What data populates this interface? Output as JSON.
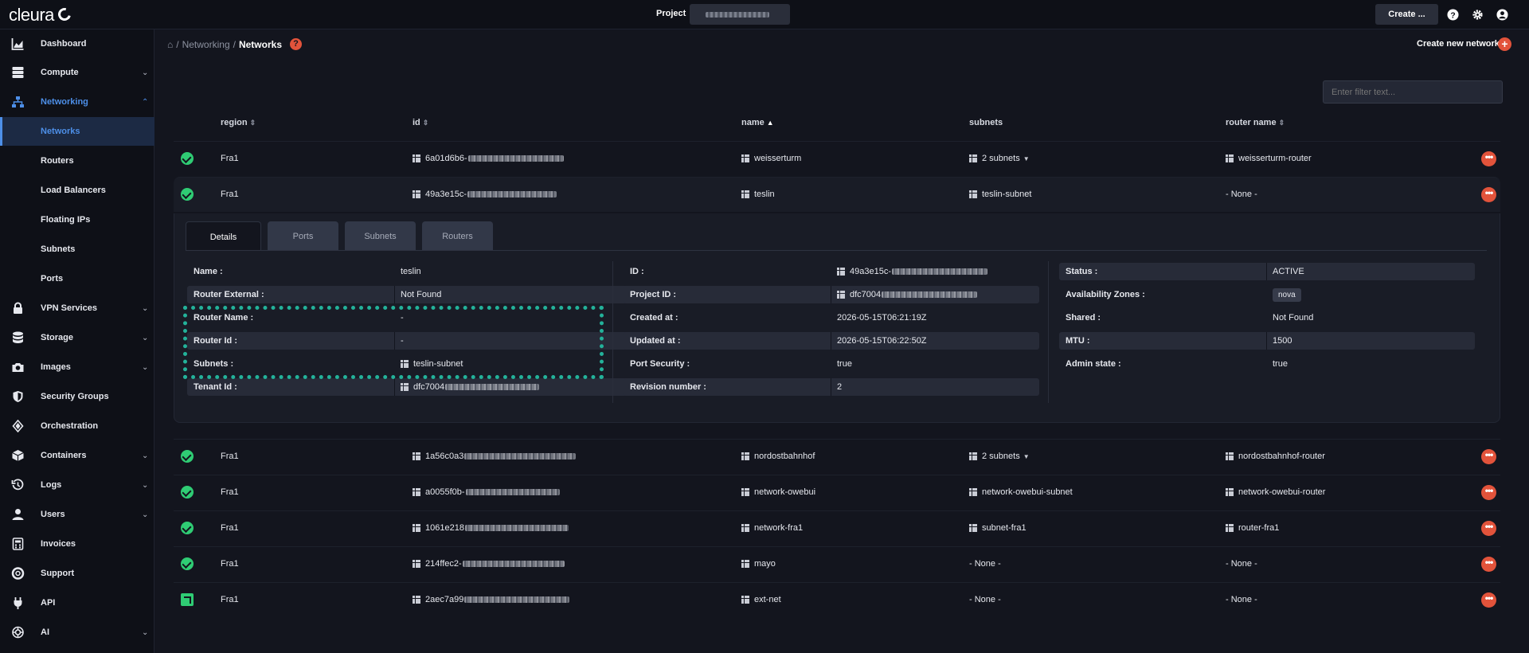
{
  "topbar": {
    "brand": "cleura",
    "project_label": "Project",
    "create_label": "Create ..."
  },
  "sidebar": {
    "items": [
      {
        "label": "Dashboard",
        "icon": "chart-icon"
      },
      {
        "label": "Compute",
        "icon": "server-icon",
        "expandable": true
      },
      {
        "label": "Networking",
        "icon": "network-icon",
        "expandable": true,
        "expanded": true,
        "active": true
      },
      {
        "label": "Networks",
        "sub": true,
        "selected": true
      },
      {
        "label": "Routers",
        "sub": true
      },
      {
        "label": "Load Balancers",
        "sub": true
      },
      {
        "label": "Floating IPs",
        "sub": true
      },
      {
        "label": "Subnets",
        "sub": true
      },
      {
        "label": "Ports",
        "sub": true
      },
      {
        "label": "VPN Services",
        "icon": "lock-icon",
        "expandable": true
      },
      {
        "label": "Storage",
        "icon": "database-icon",
        "expandable": true
      },
      {
        "label": "Images",
        "icon": "camera-icon",
        "expandable": true
      },
      {
        "label": "Security Groups",
        "icon": "shield-icon"
      },
      {
        "label": "Orchestration",
        "icon": "orchestration-icon"
      },
      {
        "label": "Containers",
        "icon": "cube-icon",
        "expandable": true
      },
      {
        "label": "Logs",
        "icon": "history-icon",
        "expandable": true
      },
      {
        "label": "Users",
        "icon": "user-icon",
        "expandable": true
      },
      {
        "label": "Invoices",
        "icon": "calculator-icon"
      },
      {
        "label": "Support",
        "icon": "lifebuoy-icon"
      },
      {
        "label": "API",
        "icon": "plug-icon"
      },
      {
        "label": "AI",
        "icon": "ai-icon",
        "expandable": true
      }
    ]
  },
  "breadcrumb": {
    "home": "⌂",
    "sep": "/",
    "parent": "Networking",
    "current": "Networks"
  },
  "actions": {
    "create_network": "Create new network"
  },
  "filter": {
    "placeholder": "Enter filter text..."
  },
  "table": {
    "headers": {
      "region": "region",
      "id": "id",
      "name": "name",
      "subnets": "subnets",
      "router": "router name"
    },
    "rows": [
      {
        "status": "active",
        "region": "Fra1",
        "id": "6a01d6b6-",
        "name": "weisserturm",
        "subnets": "2 subnets",
        "subnets_dropdown": true,
        "router": "weisserturm-router"
      },
      {
        "status": "active",
        "region": "Fra1",
        "id": "49a3e15c-",
        "name": "teslin",
        "subnets": "teslin-subnet",
        "router": "- None -"
      },
      {
        "status": "active",
        "region": "Fra1",
        "id": "1a56c0a3",
        "name": "nordostbahnhof",
        "subnets": "2 subnets",
        "subnets_dropdown": true,
        "router": "nordostbahnhof-router"
      },
      {
        "status": "active",
        "region": "Fra1",
        "id": "a0055f0b-",
        "name": "network-owebui",
        "subnets": "network-owebui-subnet",
        "router": "network-owebui-router"
      },
      {
        "status": "active",
        "region": "Fra1",
        "id": "1061e218",
        "name": "network-fra1",
        "subnets": "subnet-fra1",
        "router": "router-fra1"
      },
      {
        "status": "active",
        "region": "Fra1",
        "id": "214ffec2-",
        "name": "mayo",
        "subnets": "- None -",
        "router": "- None -"
      },
      {
        "status": "external",
        "region": "Fra1",
        "id": "2aec7a99",
        "name": "ext-net",
        "subnets": "- None -",
        "router": "- None -"
      }
    ]
  },
  "details": {
    "tabs": [
      "Details",
      "Ports",
      "Subnets",
      "Routers"
    ],
    "col1": [
      {
        "k": "Name :",
        "v": "teslin"
      },
      {
        "k": "Router External :",
        "v": "Not Found"
      },
      {
        "k": "Router Name :",
        "v": "-"
      },
      {
        "k": "Router Id :",
        "v": "-"
      },
      {
        "k": "Subnets :",
        "v": "teslin-subnet"
      },
      {
        "k": "Tenant Id :",
        "v": "dfc7004"
      }
    ],
    "col2": [
      {
        "k": "ID :",
        "v": "49a3e15c-"
      },
      {
        "k": "Project ID :",
        "v": "dfc7004"
      },
      {
        "k": "Created at :",
        "v": "2026-05-15T06:21:19Z"
      },
      {
        "k": "Updated at :",
        "v": "2026-05-15T06:22:50Z"
      },
      {
        "k": "Port Security :",
        "v": "true"
      },
      {
        "k": "Revision number :",
        "v": "2"
      }
    ],
    "col3": [
      {
        "k": "Status :",
        "v": "ACTIVE"
      },
      {
        "k": "Availability Zones :",
        "v": "nova"
      },
      {
        "k": "Shared :",
        "v": "Not Found"
      },
      {
        "k": "MTU :",
        "v": "1500"
      },
      {
        "k": "Admin state :",
        "v": "true"
      }
    ]
  },
  "colors": {
    "accent": "#4d8fe8",
    "danger": "#e2533b",
    "success": "#2fcc74",
    "highlight": "#23b29a"
  }
}
